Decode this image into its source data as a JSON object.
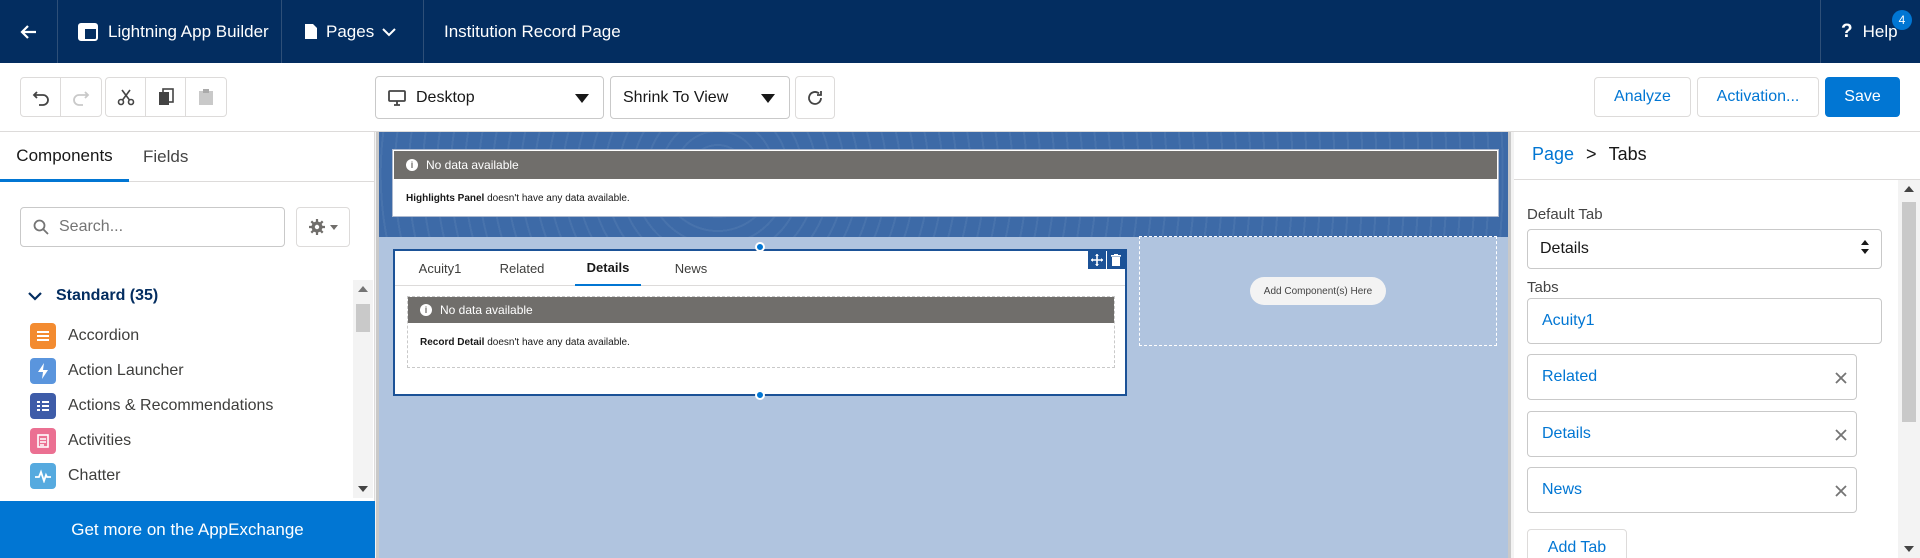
{
  "colors": {
    "header_bg": "#032d60",
    "brand": "#0176d3",
    "canvas_bg": "#b0c4df",
    "canvas_header": "#3d6aa7",
    "nodata_bar": "#706e6b"
  },
  "header": {
    "app_name": "Lightning App Builder",
    "pages_label": "Pages",
    "record_page": "Institution Record Page",
    "help_label": "Help",
    "help_badge": "4"
  },
  "toolbar": {
    "device_select": "Desktop",
    "view_select": "Shrink To View",
    "analyze_label": "Analyze",
    "activation_label": "Activation...",
    "save_label": "Save"
  },
  "left_panel": {
    "tabs": [
      "Components",
      "Fields"
    ],
    "search_placeholder": "Search...",
    "section_title": "Standard (35)",
    "components": [
      {
        "label": "Accordion",
        "icon": "accordion-icon",
        "color": "#f38b30"
      },
      {
        "label": "Action Launcher",
        "icon": "lightning-bolt-icon",
        "color": "#5a95dd"
      },
      {
        "label": "Actions & Recommendations",
        "icon": "actions-list-icon",
        "color": "#3e5ca8"
      },
      {
        "label": "Activities",
        "icon": "activities-icon",
        "color": "#eb7092"
      },
      {
        "label": "Chatter",
        "icon": "chatter-pulse-icon",
        "color": "#56aadf"
      }
    ],
    "appexchange_label": "Get more on the AppExchange"
  },
  "canvas": {
    "highlights": {
      "title": "No data available",
      "component_name": "Highlights Panel",
      "message": " doesn't have any data available."
    },
    "tabs": [
      "Acuity1",
      "Related",
      "Details",
      "News"
    ],
    "active_tab": "Details",
    "record_detail": {
      "title": "No data available",
      "component_name": "Record Detail",
      "message": " doesn't have any data available."
    },
    "add_component_label": "Add Component(s) Here"
  },
  "right_panel": {
    "breadcrumb_page": "Page",
    "breadcrumb_sep": ">",
    "breadcrumb_current": "Tabs",
    "default_tab_label": "Default Tab",
    "default_tab_value": "Details",
    "tabs_label": "Tabs",
    "tab_entries": [
      "Acuity1",
      "Related",
      "Details",
      "News"
    ],
    "add_tab_label": "Add Tab"
  }
}
